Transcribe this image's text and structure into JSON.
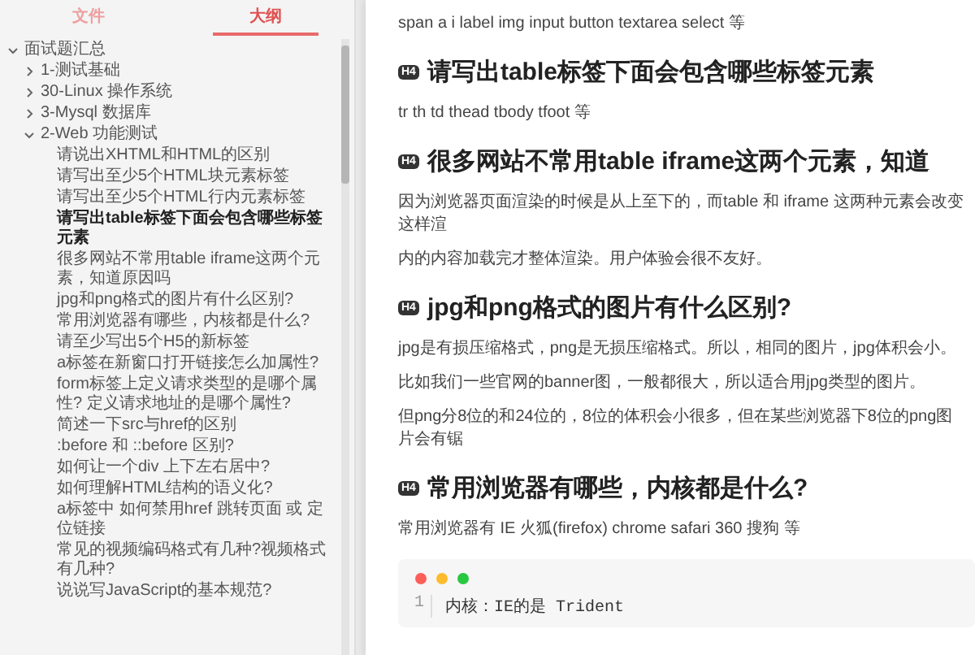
{
  "sidebar": {
    "tabs": [
      {
        "label": "文件",
        "selected": false
      },
      {
        "label": "大纲",
        "selected": true
      }
    ],
    "outline": [
      {
        "label": "面试题汇总",
        "expanded": true,
        "selected": false,
        "children": [
          {
            "label": "1-测试基础",
            "expanded": false,
            "selected": false
          },
          {
            "label": "30-Linux 操作系统",
            "expanded": false,
            "selected": false
          },
          {
            "label": "3-Mysql 数据库",
            "expanded": false,
            "selected": false
          },
          {
            "label": "2-Web 功能测试",
            "expanded": true,
            "selected": false,
            "children": [
              {
                "label": "请说出XHTML和HTML的区别",
                "selected": false
              },
              {
                "label": "请写出至少5个HTML块元素标签",
                "selected": false
              },
              {
                "label": "请写出至少5个HTML行内元素标签",
                "selected": false
              },
              {
                "label": "请写出table标签下面会包含哪些标签元素",
                "selected": true
              },
              {
                "label": "很多网站不常用table iframe这两个元素，知道原因吗",
                "selected": false
              },
              {
                "label": "jpg和png格式的图片有什么区别?",
                "selected": false
              },
              {
                "label": "常用浏览器有哪些，内核都是什么?",
                "selected": false
              },
              {
                "label": "请至少写出5个H5的新标签",
                "selected": false
              },
              {
                "label": "a标签在新窗口打开链接怎么加属性?",
                "selected": false
              },
              {
                "label": "form标签上定义请求类型的是哪个属性? 定义请求地址的是哪个属性?",
                "selected": false
              },
              {
                "label": "简述一下src与href的区别",
                "selected": false
              },
              {
                "label": ":before 和 ::before 区别?",
                "selected": false
              },
              {
                "label": "如何让一个div 上下左右居中?",
                "selected": false
              },
              {
                "label": "如何理解HTML结构的语义化?",
                "selected": false
              },
              {
                "label": "a标签中 如何禁用href 跳转页面 或 定位链接",
                "selected": false
              },
              {
                "label": "常见的视频编码格式有几种?视频格式有几种?",
                "selected": false
              },
              {
                "label": "说说写JavaScript的基本规范?",
                "selected": false
              }
            ]
          }
        ]
      }
    ]
  },
  "document": [
    {
      "kind": "paragraph",
      "text": "span  a  i  label  img  input  button  textarea select 等"
    },
    {
      "kind": "heading",
      "badge": "H4",
      "text": "请写出table标签下面会包含哪些标签元素"
    },
    {
      "kind": "paragraph",
      "text": "tr th  td  thead  tbody  tfoot 等"
    },
    {
      "kind": "heading",
      "badge": "H4",
      "text": "很多网站不常用table  iframe这两个元素，知道"
    },
    {
      "kind": "paragraph",
      "text": "因为浏览器页面渲染的时候是从上至下的，而table 和 iframe 这两种元素会改变这样渲"
    },
    {
      "kind": "paragraph",
      "text": "内的内容加载完才整体渲染。用户体验会很不友好。"
    },
    {
      "kind": "heading",
      "badge": "H4",
      "text": "jpg和png格式的图片有什么区别?"
    },
    {
      "kind": "paragraph",
      "text": "jpg是有损压缩格式，png是无损压缩格式。所以，相同的图片，jpg体积会小。"
    },
    {
      "kind": "paragraph",
      "text": "比如我们一些官网的banner图，一般都很大，所以适合用jpg类型的图片。"
    },
    {
      "kind": "paragraph",
      "text": "但png分8位的和24位的，8位的体积会小很多，但在某些浏览器下8位的png图片会有锯"
    },
    {
      "kind": "heading",
      "badge": "H4",
      "text": "常用浏览器有哪些，内核都是什么?"
    },
    {
      "kind": "paragraph",
      "text": "常用浏览器有 IE 火狐(firefox)  chrome safari  360 搜狗 等"
    },
    {
      "kind": "code",
      "lines": [
        {
          "number": "1",
          "text": "内核：IE的是 Trident"
        }
      ]
    }
  ]
}
